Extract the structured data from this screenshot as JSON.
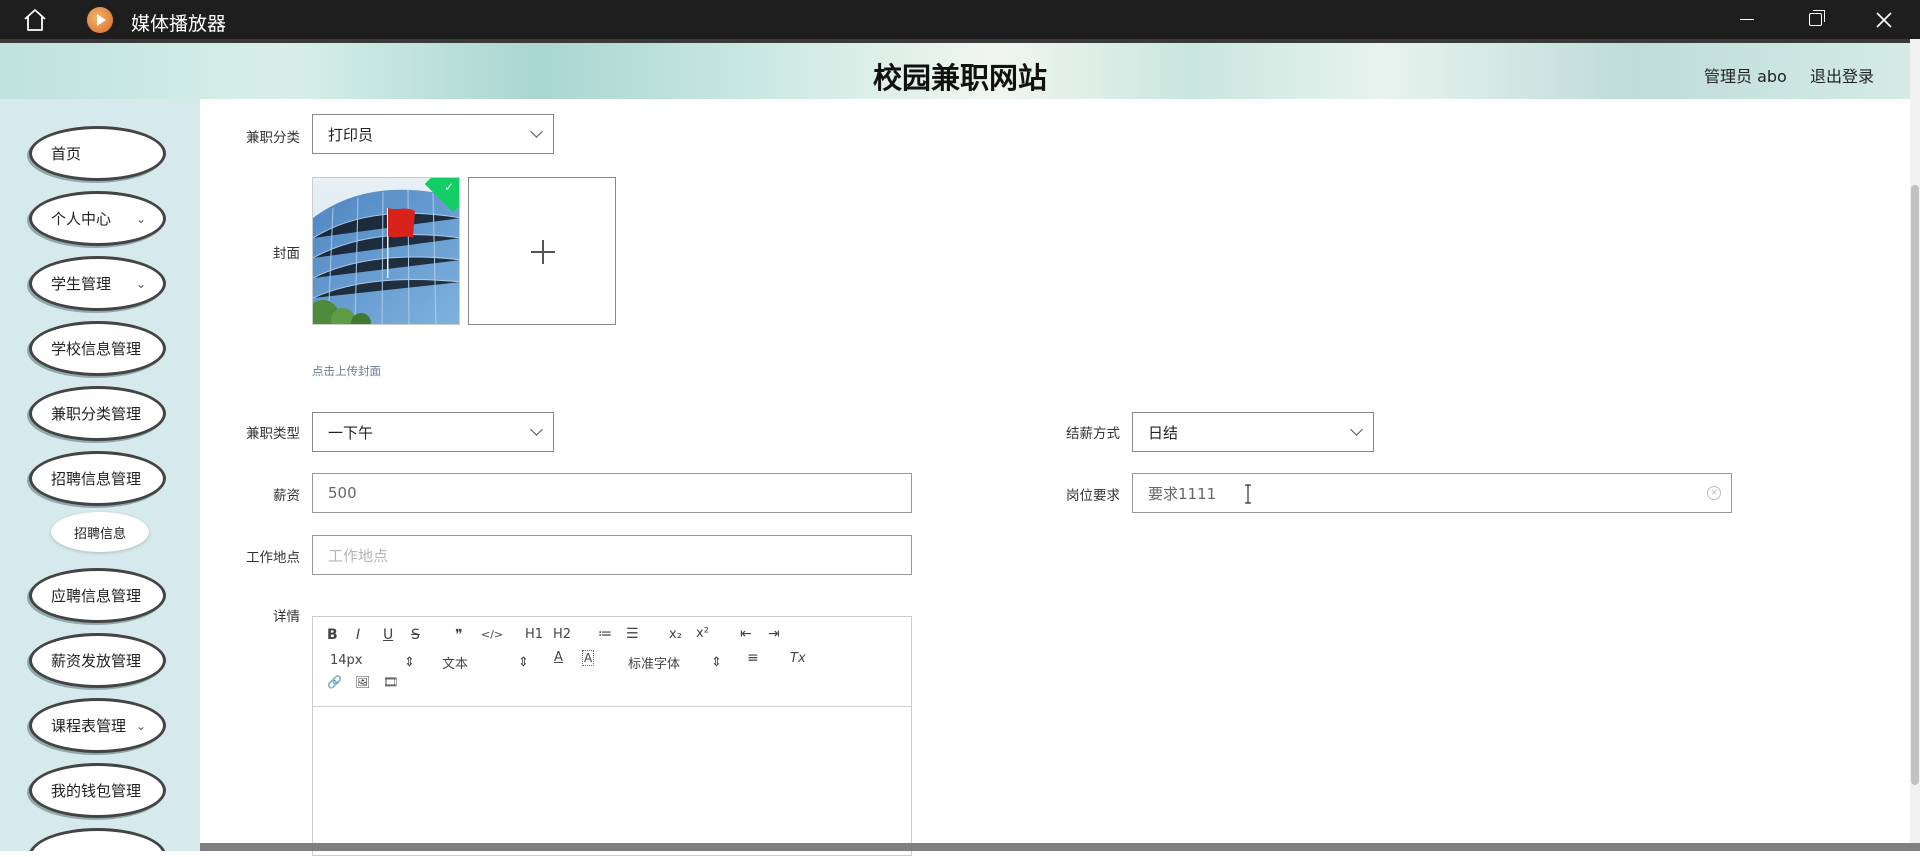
{
  "window": {
    "title": "媒体播放器"
  },
  "header": {
    "site_title": "校园兼职网站",
    "admin_label": "管理员 abo",
    "logout_label": "退出登录"
  },
  "sidebar": {
    "items": [
      {
        "label": "首页",
        "has_chevron": false
      },
      {
        "label": "个人中心",
        "has_chevron": true,
        "chevron": "⌄"
      },
      {
        "label": "学生管理",
        "has_chevron": true,
        "chevron": "⌄"
      },
      {
        "label": "学校信息管理",
        "has_chevron": false
      },
      {
        "label": "兼职分类管理",
        "has_chevron": false
      },
      {
        "label": "招聘信息管理",
        "has_chevron": false
      },
      {
        "label": "应聘信息管理",
        "has_chevron": false
      },
      {
        "label": "薪资发放管理",
        "has_chevron": false
      },
      {
        "label": "课程表管理",
        "has_chevron": true,
        "chevron": "⌄"
      },
      {
        "label": "我的钱包管理",
        "has_chevron": false
      }
    ],
    "sub_item": {
      "label": "招聘信息"
    }
  },
  "form": {
    "category": {
      "label": "兼职分类",
      "value": "打印员"
    },
    "cover": {
      "label": "封面",
      "hint": "点击上传封面",
      "check": "✓"
    },
    "job_type": {
      "label": "兼职类型",
      "value": "一下午"
    },
    "settlement": {
      "label": "结薪方式",
      "value": "日结"
    },
    "salary": {
      "label": "薪资",
      "value": "500"
    },
    "requirement": {
      "label": "岗位要求",
      "value": "要求1111",
      "clear": "×"
    },
    "location": {
      "label": "工作地点",
      "placeholder": "工作地点"
    },
    "details": {
      "label": "详情"
    }
  },
  "editor": {
    "tools_row1": [
      "B",
      "I",
      "U",
      "S",
      "❞",
      "</>",
      "H1",
      "H2",
      "≔",
      "☰",
      "x₂",
      "x²",
      "⇤",
      "⇥"
    ],
    "font_size": "14px",
    "paragraph": "文本",
    "font_family": "标准字体",
    "updown": "⇕",
    "color_a": "A",
    "bg_a": "A",
    "align": "≡",
    "clear_format": "Tx",
    "tools_row3": [
      "🔗",
      "🖼",
      "🎞"
    ]
  },
  "colors": {
    "accent_green": "#13ce66",
    "sidebar_bg": "#d6e9ec"
  }
}
